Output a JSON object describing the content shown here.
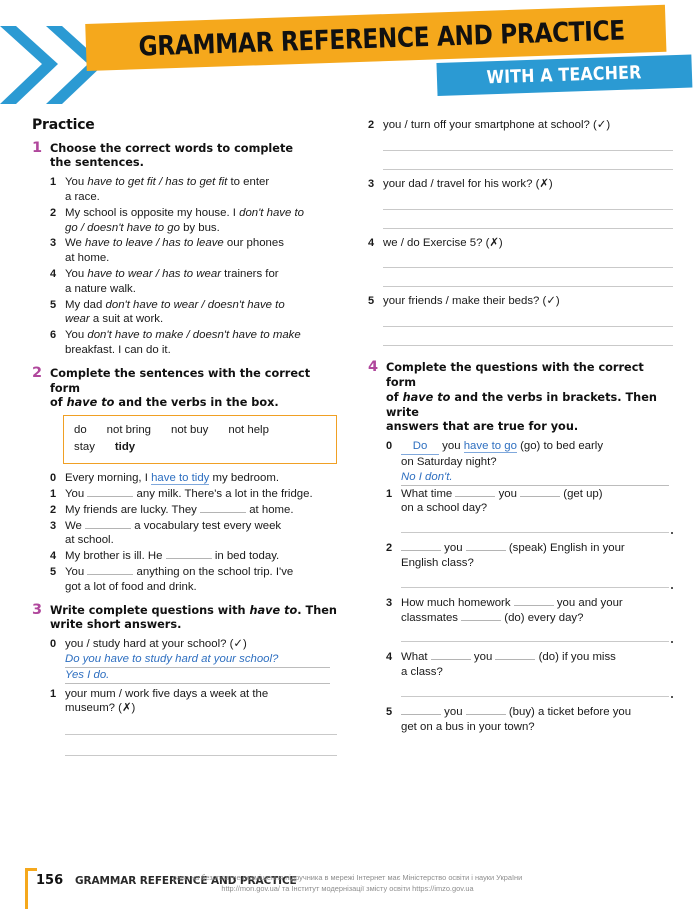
{
  "header": {
    "title": "GRAMMAR REFERENCE AND PRACTICE",
    "tab_label": "WITH A TEACHER",
    "chevron_icon": "double-chevron-right-icon",
    "colors": {
      "orange": "#F5A81C",
      "blue": "#2B9AD3",
      "exercise_number": "#B0479C",
      "answer_blue": "#2E6FC0"
    }
  },
  "page": {
    "section_title": "Practice"
  },
  "exercises": {
    "ex1": {
      "number": "1",
      "rubric_a": "Choose the correct words to complete",
      "rubric_b": "the sentences.",
      "items": [
        {
          "n": "1",
          "l1_pre": "You ",
          "l1_it": "have to get fit / has to get fit",
          "l1_post": " to enter",
          "l2": "a race."
        },
        {
          "n": "2",
          "l1_pre": "My school is opposite my house. I ",
          "l1_it": "don't have to",
          "l1_post": "",
          "l2_it": "go / doesn't have to go",
          "l2_post": " by bus."
        },
        {
          "n": "3",
          "l1_pre": "We ",
          "l1_it": "have to leave / has to leave",
          "l1_post": " our phones",
          "l2": "at home."
        },
        {
          "n": "4",
          "l1_pre": "You ",
          "l1_it": "have to wear / has to wear",
          "l1_post": " trainers for",
          "l2": "a nature walk."
        },
        {
          "n": "5",
          "l1_pre": "My dad ",
          "l1_it": "don't have to wear / doesn't have to",
          "l1_post": "",
          "l2_it": "wear",
          "l2_post": " a suit at work."
        },
        {
          "n": "6",
          "l1_pre": "You ",
          "l1_it": "don't have to make / doesn't have to make",
          "l1_post": "",
          "l2": "breakfast. I can do it."
        }
      ]
    },
    "ex2": {
      "number": "2",
      "rubric_a": "Complete the sentences with the correct form",
      "rubric_b_pre": "of ",
      "rubric_b_it": "have to",
      "rubric_b_post": " and the verbs in the box.",
      "wordbox": [
        "do",
        "not bring",
        "not buy",
        "not help",
        "stay",
        "tidy"
      ],
      "wordbox_highlight": "tidy",
      "items": [
        {
          "n": "0",
          "pre": "Every morning, I ",
          "answer": "have to tidy",
          "post": " my bedroom."
        },
        {
          "n": "1",
          "pre": "You ",
          "post": " any milk. There's a lot in the fridge."
        },
        {
          "n": "2",
          "pre": "My friends are lucky. They ",
          "post": " at home."
        },
        {
          "n": "3",
          "pre": "We ",
          "post": " a vocabulary test every week",
          "l2": "at school."
        },
        {
          "n": "4",
          "pre": "My brother is ill. He ",
          "post": " in bed today."
        },
        {
          "n": "5",
          "pre": "You ",
          "post": " anything on the school trip. I've",
          "l2": "got a lot of food and drink."
        }
      ]
    },
    "ex3": {
      "number": "3",
      "rubric_a_pre": "Write complete questions with ",
      "rubric_a_it": "have to",
      "rubric_a_post": ". Then",
      "rubric_b": "write short answers.",
      "example": {
        "n": "0",
        "prompt": "you / study hard at your school? (✓)",
        "answer_q": "Do you have to study hard at your school?",
        "answer_a": "Yes I do."
      },
      "items": [
        {
          "n": "1",
          "l1": "your mum / work five days a week at the",
          "l2": "museum? (✗)"
        },
        {
          "n": "2",
          "l1": "you / turn off your smartphone at school? (✓)"
        },
        {
          "n": "3",
          "l1": "your dad / travel for his work? (✗)"
        },
        {
          "n": "4",
          "l1": "we / do Exercise 5? (✗)"
        },
        {
          "n": "5",
          "l1": "your friends / make their beds? (✓)"
        }
      ]
    },
    "ex4": {
      "number": "4",
      "rubric_a": "Complete the questions with the correct form",
      "rubric_b_pre": "of ",
      "rubric_b_it": "have to",
      "rubric_b_post": " and the verbs in brackets. Then write",
      "rubric_c": "answers that are true for you.",
      "example": {
        "n": "0",
        "fill1": "Do",
        "mid": " you ",
        "fill2": "have to go",
        "post": " (go) to bed early",
        "l2": "on Saturday night?",
        "answer": "No I don't."
      },
      "items": [
        {
          "n": "1",
          "pre": "What time ",
          "mid": " you ",
          "post": " (get up)",
          "l2": "on a school day?"
        },
        {
          "n": "2",
          "pre": "",
          "mid": " you ",
          "post": " (speak) English in your",
          "l2": "English class?"
        },
        {
          "n": "3",
          "pre": "How much homework ",
          "mid": " you and your",
          "l2_pre": "classmates ",
          "l2_post": " (do) every day?"
        },
        {
          "n": "4",
          "pre": "What ",
          "mid": " you ",
          "post": " (do) if you miss",
          "l2": "a class?"
        },
        {
          "n": "5",
          "pre": "",
          "mid": " you ",
          "post": " (buy) a ticket before you",
          "l2": "get on a bus in your town?"
        }
      ]
    }
  },
  "footer": {
    "page_number": "156",
    "title": "GRAMMAR REFERENCE AND PRACTICE",
    "watermark_line1": "раво на безоплатне розміщення підручника в мережі Інтернет має Міністерство освіти і науки України",
    "watermark_line2": "http://mon.gov.ua/ та Інститут модернізації змісту освіти https://imzo.gov.ua"
  }
}
